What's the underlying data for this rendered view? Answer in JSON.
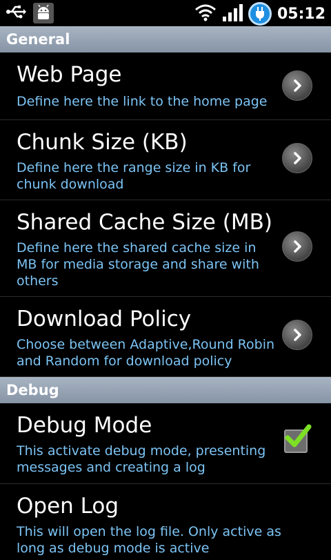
{
  "status_bar": {
    "time": "05:12",
    "icons": [
      "usb-icon",
      "android-debug-icon",
      "wifi-icon",
      "signal-icon",
      "battery-charging-icon"
    ]
  },
  "sections": [
    {
      "header": "General",
      "items": [
        {
          "title": "Web Page",
          "summary": "Define here the link to the home page",
          "widget": "chevron"
        },
        {
          "title": "Chunk Size (KB)",
          "summary": "Define here the range size in KB for chunk download",
          "widget": "chevron"
        },
        {
          "title": "Shared Cache Size (MB)",
          "summary": "Define here the shared cache size in MB for media storage and share with others",
          "widget": "chevron"
        },
        {
          "title": "Download Policy",
          "summary": "Choose between Adaptive,Round Robin and Random for download policy",
          "widget": "chevron"
        }
      ]
    },
    {
      "header": "Debug",
      "items": [
        {
          "title": "Debug Mode",
          "summary": "This activate debug mode, presenting messages and creating a log",
          "widget": "checkbox",
          "checked": true
        },
        {
          "title": "Open Log",
          "summary": "This will open the log file. Only active as long as debug mode is active",
          "widget": "none"
        }
      ]
    }
  ],
  "colors": {
    "summary_text": "#7cc4f5",
    "header_bg": "#97a3b3",
    "check": "#7de024"
  }
}
